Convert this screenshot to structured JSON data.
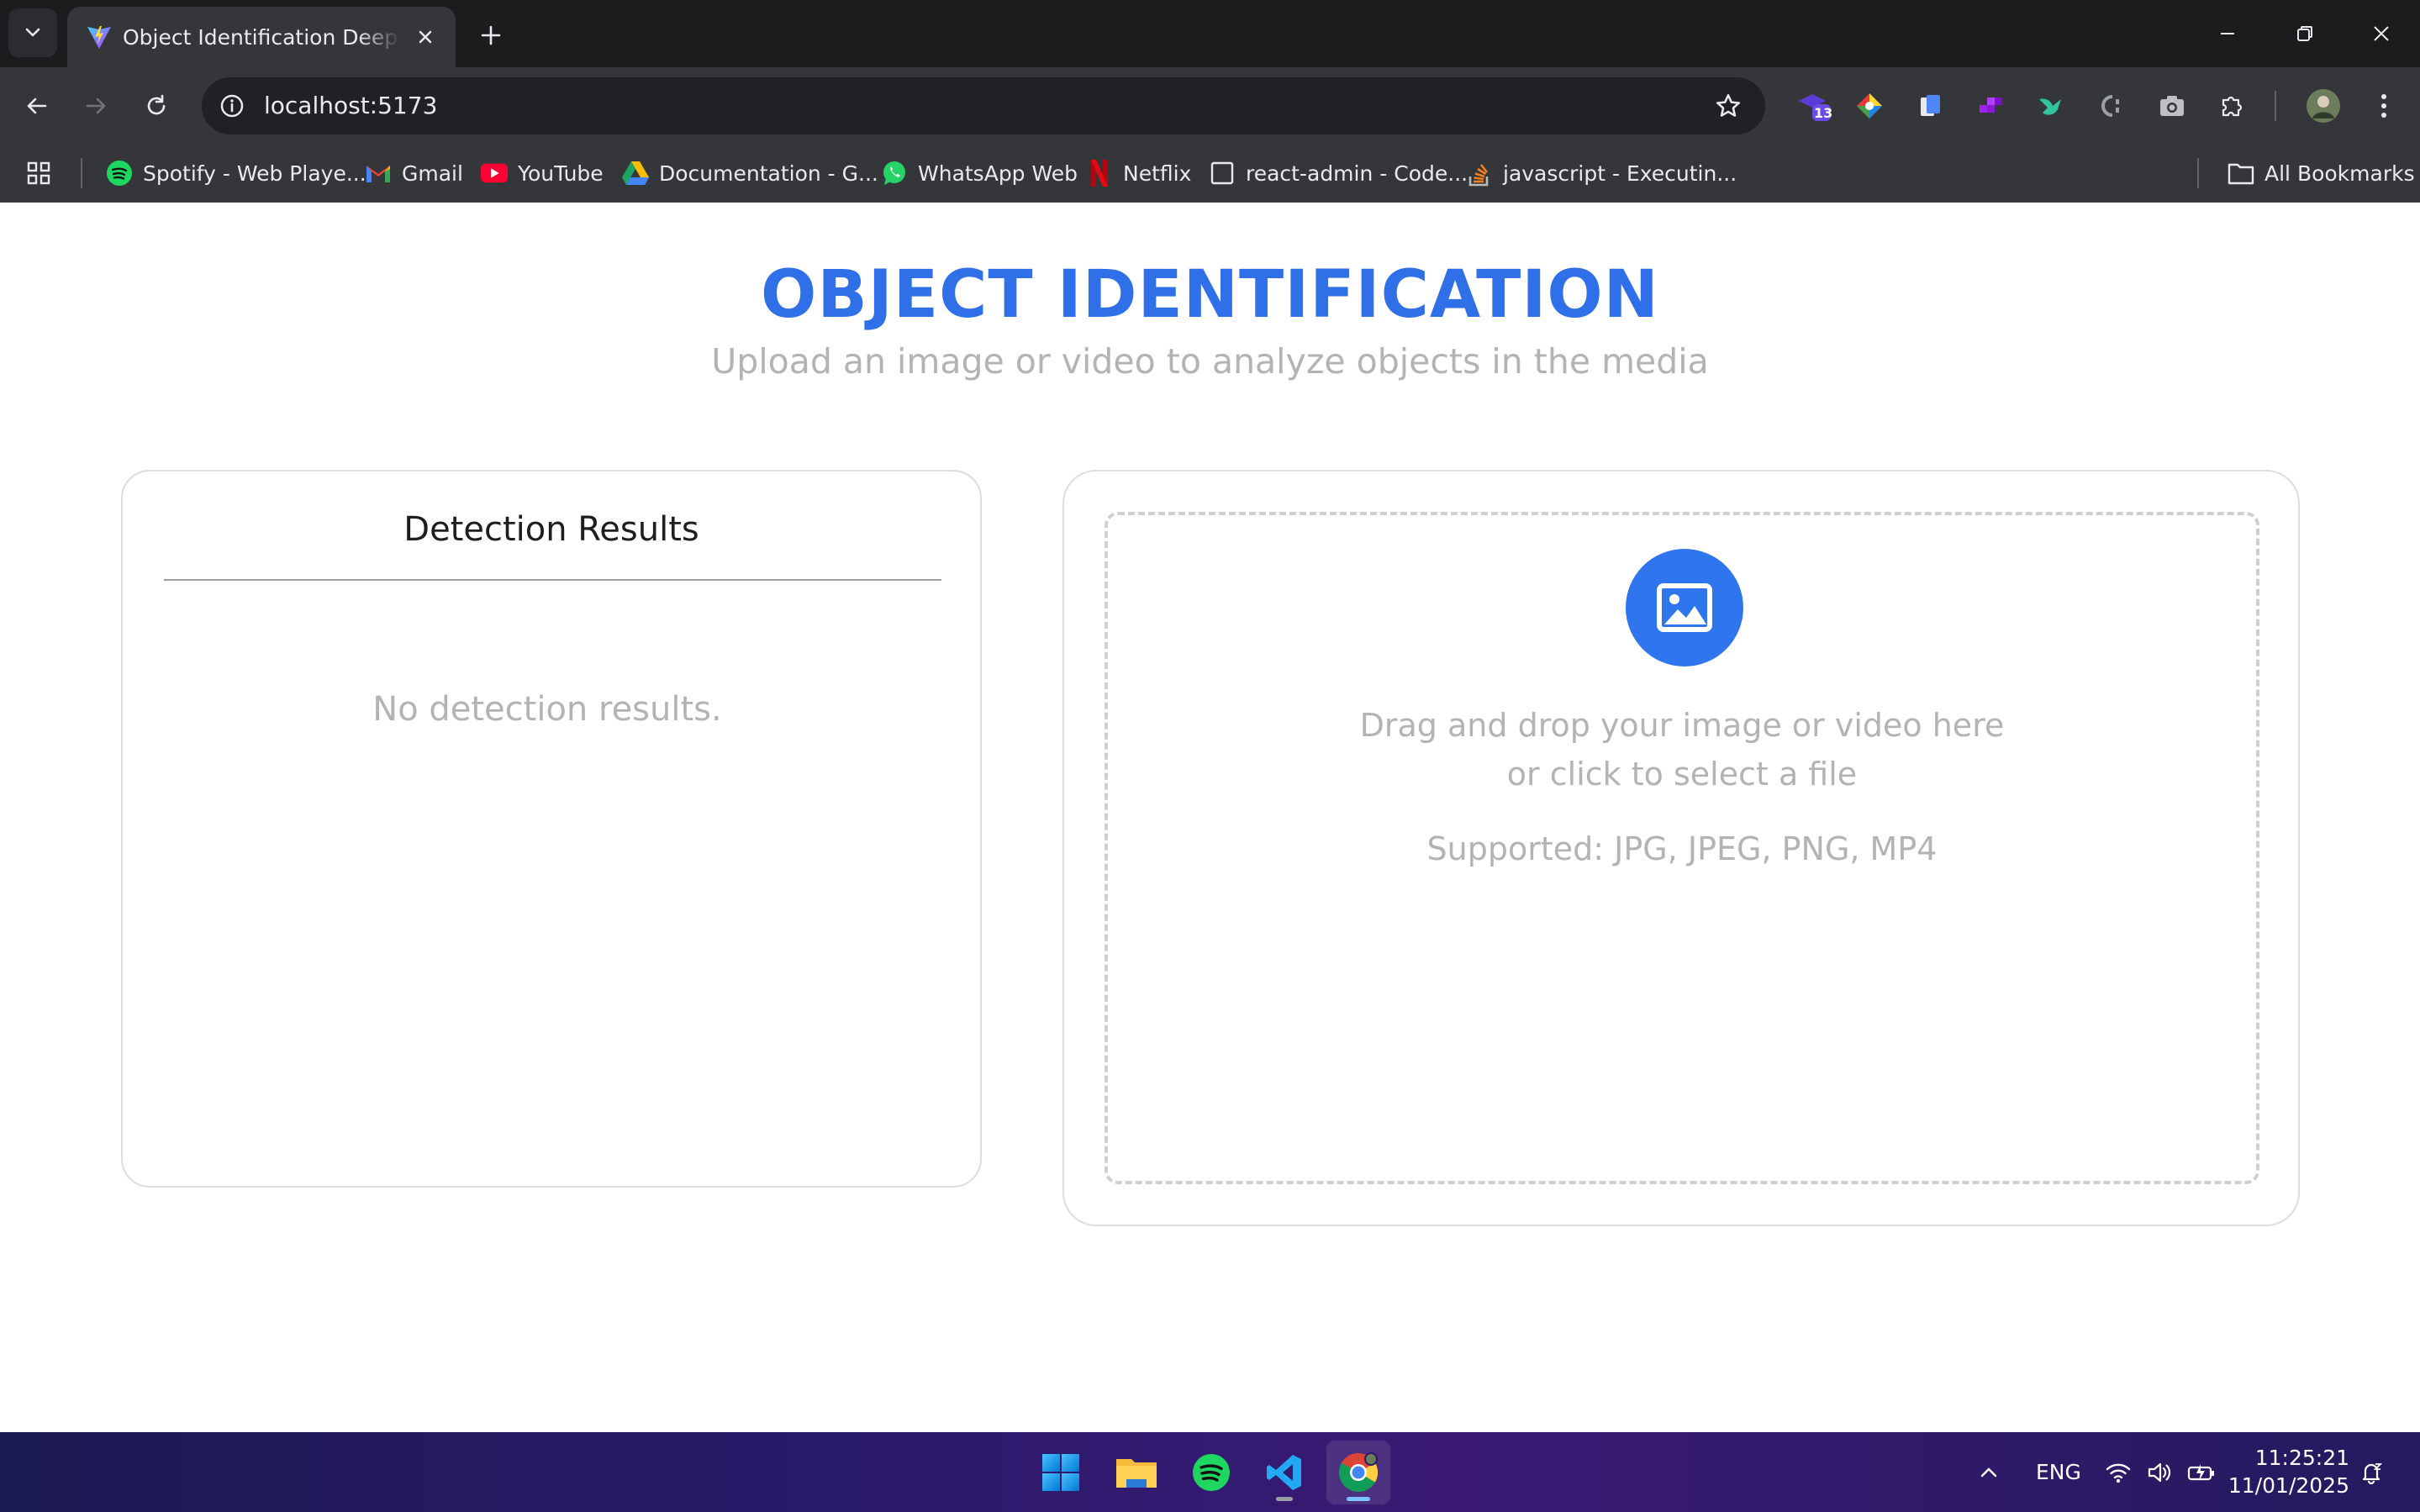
{
  "browser": {
    "tab": {
      "title": "Object Identification Deep Learning"
    },
    "url": "localhost:5173",
    "bookmarks": [
      {
        "label": "Spotify - Web Playe...",
        "icon": "spotify-icon"
      },
      {
        "label": "Gmail",
        "icon": "gmail-icon"
      },
      {
        "label": "YouTube",
        "icon": "youtube-icon"
      },
      {
        "label": "Documentation - G...",
        "icon": "google-drive-icon"
      },
      {
        "label": "WhatsApp Web",
        "icon": "whatsapp-icon"
      },
      {
        "label": "Netflix",
        "icon": "netflix-icon"
      },
      {
        "label": "react-admin - Code...",
        "icon": "blank-page-icon"
      },
      {
        "label": "javascript - Executin...",
        "icon": "stackoverflow-icon"
      }
    ],
    "all_bookmarks_label": "All Bookmarks",
    "extension_badge": "13"
  },
  "page": {
    "title": "OBJECT IDENTIFICATION",
    "subtitle": "Upload an image or video to analyze objects in the media",
    "results": {
      "heading": "Detection Results",
      "empty_message": "No detection results."
    },
    "upload": {
      "line1": "Drag and drop your image or video here",
      "line2": "or click to select a file",
      "supported": "Supported: JPG, JPEG, PNG, MP4"
    },
    "colors": {
      "accent": "#2f6fe8",
      "muted_text": "#b3b3b3"
    }
  },
  "taskbar": {
    "language": "ENG",
    "time": "11:25:21",
    "date": "11/01/2025",
    "apps": [
      "windows-start-icon",
      "file-explorer-icon",
      "spotify-icon",
      "vscode-icon",
      "chrome-icon"
    ]
  }
}
